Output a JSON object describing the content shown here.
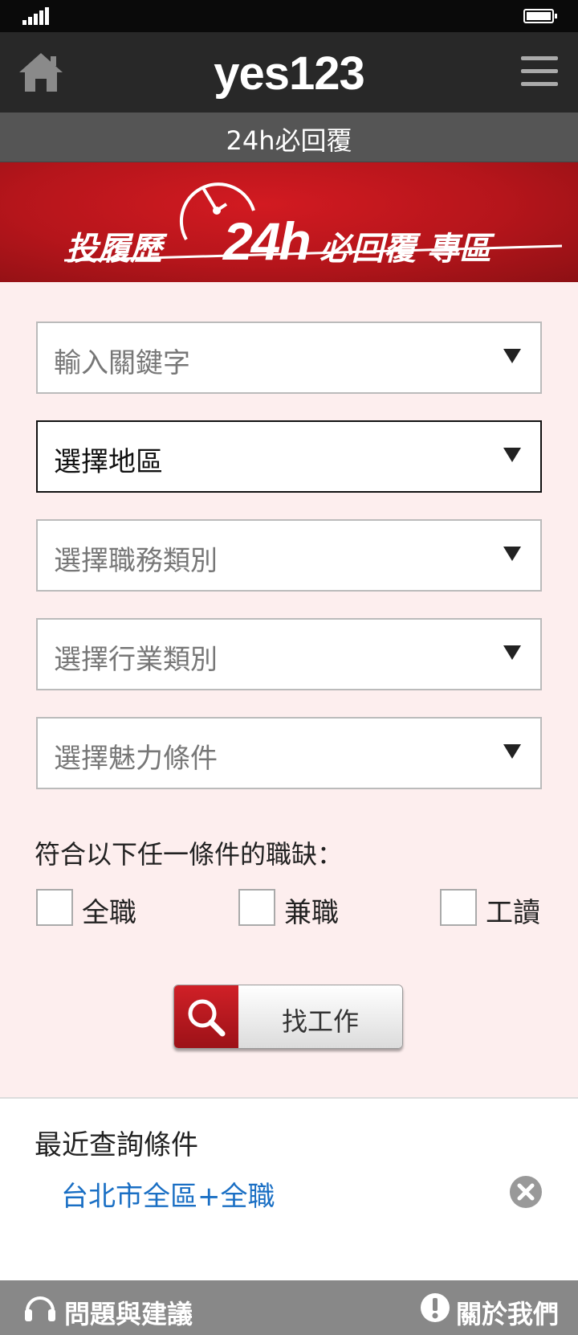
{
  "header": {
    "logo": "yes123",
    "subtitle": "24h必回覆"
  },
  "banner": {
    "text_left": "投履歷",
    "text_24h": "24h",
    "text_right": "必回覆 專區"
  },
  "filters": [
    {
      "label": "輸入關鍵字"
    },
    {
      "label": "選擇地區"
    },
    {
      "label": "選擇職務類別"
    },
    {
      "label": "選擇行業類別"
    },
    {
      "label": "選擇魅力條件"
    }
  ],
  "conditions": {
    "label": "符合以下任一條件的職缺：",
    "options": [
      "全職",
      "兼職",
      "工讀"
    ]
  },
  "search_button": {
    "label": "找工作"
  },
  "recent": {
    "title": "最近查詢條件",
    "items": [
      "台北市全區+全職"
    ]
  },
  "footer": {
    "feedback": "問題與建議",
    "about": "關於我們"
  },
  "colors": {
    "brand_red": "#c8161d",
    "appbar": "#282828",
    "page_bg": "#fdeeee",
    "link_blue": "#1a6fc4"
  }
}
